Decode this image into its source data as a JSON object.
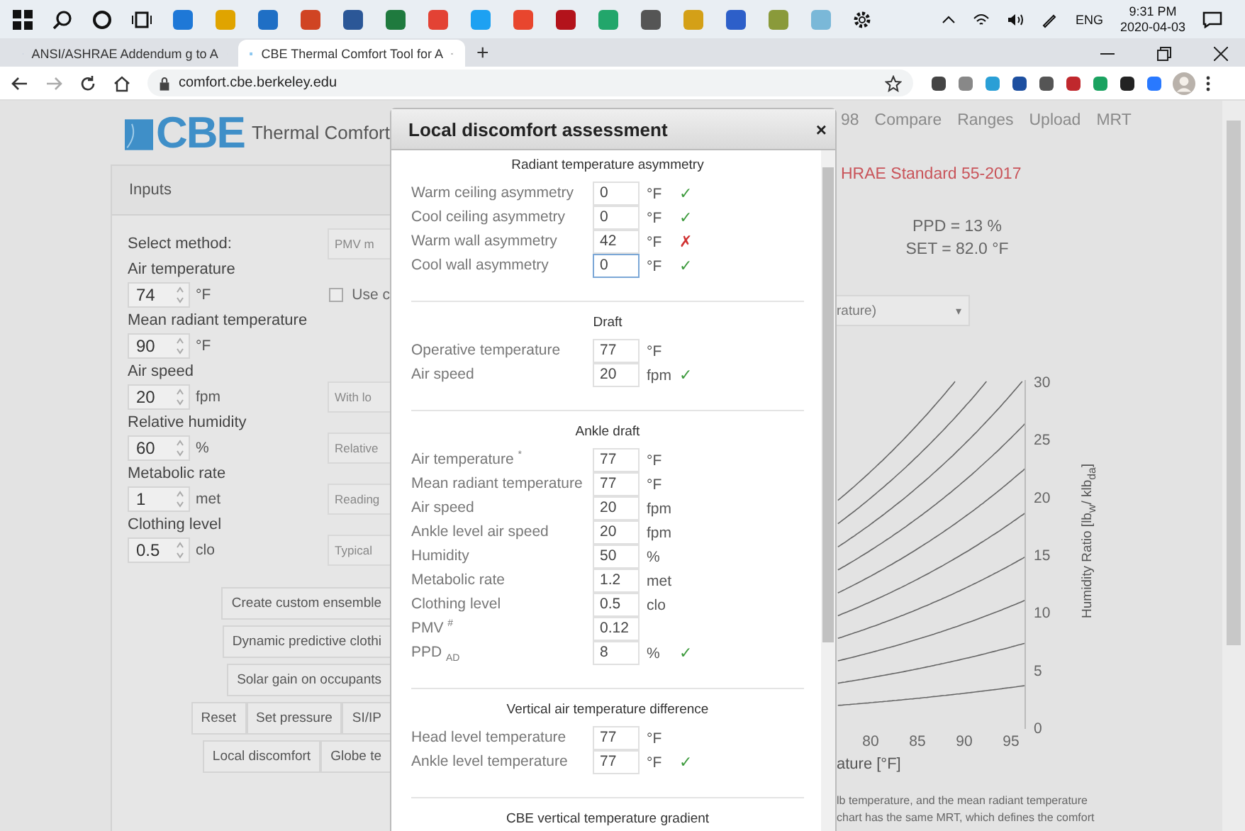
{
  "taskbar": {
    "language": "ENG",
    "time": "9:31 PM",
    "date": "2020-04-03"
  },
  "browser": {
    "tabs": [
      {
        "title": "ANSI/ASHRAE Addendum g to A",
        "selected": false
      },
      {
        "title": "CBE Thermal Comfort Tool for A",
        "selected": true
      }
    ],
    "new_tab": "+",
    "url": "comfort.cbe.berkeley.edu"
  },
  "page": {
    "logo": "CBE",
    "app_title": "Thermal Comfort",
    "nav": [
      "98",
      "Compare",
      "Ranges",
      "Upload",
      "MRT"
    ],
    "inputs": {
      "title": "Inputs",
      "method_label": "Select method:",
      "method_select": "PMV m",
      "fields": [
        {
          "label": "Air temperature",
          "value": "74",
          "unit": "°F",
          "side": {
            "kind": "checkbox",
            "label": "Use c",
            "checked": false
          }
        },
        {
          "label": "Mean radiant temperature",
          "value": "90",
          "unit": "°F"
        },
        {
          "label": "Air speed",
          "value": "20",
          "unit": "fpm",
          "side": {
            "kind": "select",
            "label": "With lo"
          }
        },
        {
          "label": "Relative humidity",
          "value": "60",
          "unit": "%",
          "side": {
            "kind": "select",
            "label": "Relative"
          }
        },
        {
          "label": "Metabolic rate",
          "value": "1",
          "unit": "met",
          "side": {
            "kind": "select",
            "label": "Reading"
          }
        },
        {
          "label": "Clothing level",
          "value": "0.5",
          "unit": "clo",
          "side": {
            "kind": "select",
            "label": "Typical"
          }
        }
      ]
    },
    "button_rows": [
      [
        "Create custom ensemble"
      ],
      [
        "Dynamic predictive clothi"
      ],
      [
        "Solar gain on occupants"
      ],
      [
        "Reset",
        "Set pressure",
        "SI/IP"
      ],
      [
        "Local discomfort",
        "Globe te"
      ]
    ],
    "standard": "HRAE Standard 55-2017",
    "results": [
      "PPD = 13 %",
      "SET = 82.0 °F"
    ],
    "chart_select": "rature)",
    "chart_select_caret": "▾",
    "chart": {
      "x_ticks": [
        "80",
        "85",
        "90",
        "95"
      ],
      "y_ticks": [
        "30",
        "25",
        "20",
        "15",
        "10",
        "5",
        "0"
      ],
      "x_label": "ature [°F]",
      "y_label": "Humidity Ratio [lb$_{w}$/ klb$_{da}$]"
    },
    "footnote": [
      "lb temperature, and the mean radiant temperature",
      "chart has the same MRT, which defines the comfort"
    ]
  },
  "modal": {
    "title": "Local discomfort assessment",
    "close": "×",
    "sections": [
      {
        "title": "Radiant temperature asymmetry",
        "rows": [
          {
            "label": "Warm ceiling asymmetry",
            "value": "0",
            "unit": "°F",
            "ok": true,
            "mark": "✓",
            "focused": false
          },
          {
            "label": "Cool ceiling asymmetry",
            "value": "0",
            "unit": "°F",
            "ok": true,
            "mark": "✓",
            "focused": false
          },
          {
            "label": "Warm wall asymmetry",
            "value": "42",
            "unit": "°F",
            "ok": false,
            "mark": "✗",
            "focused": false
          },
          {
            "label": "Cool wall asymmetry",
            "value": "0",
            "unit": "°F",
            "ok": true,
            "mark": "✓",
            "focused": true
          }
        ]
      },
      {
        "title": "Draft",
        "rows": [
          {
            "label": "Operative temperature",
            "value": "77",
            "unit": "°F",
            "focused": false
          },
          {
            "label": "Air speed",
            "value": "20",
            "unit": "fpm",
            "ok": true,
            "mark": "✓",
            "focused": false
          }
        ]
      },
      {
        "title": "Ankle draft",
        "rows": [
          {
            "label": "Air temperature $^{*}$",
            "value": "77",
            "unit": "°F",
            "focused": false
          },
          {
            "label": "Mean radiant temperature",
            "value": "77",
            "unit": "°F",
            "focused": false
          },
          {
            "label": "Air speed",
            "value": "20",
            "unit": "fpm",
            "focused": false
          },
          {
            "label": "Ankle level air speed",
            "value": "20",
            "unit": "fpm",
            "focused": false
          },
          {
            "label": "Humidity",
            "value": "50",
            "unit": "%",
            "focused": false
          },
          {
            "label": "Metabolic rate",
            "value": "1.2",
            "unit": "met",
            "focused": false
          },
          {
            "label": "Clothing level",
            "value": "0.5",
            "unit": "clo",
            "focused": false
          },
          {
            "label": "PMV $^{#}$",
            "value": "0.12",
            "focused": false
          },
          {
            "label": "PPD $_{AD}$",
            "value": "8",
            "unit": "%",
            "ok": true,
            "mark": "✓",
            "focused": false
          }
        ]
      },
      {
        "title": "Vertical air temperature difference",
        "rows": [
          {
            "label": "Head level temperature",
            "value": "77",
            "unit": "°F",
            "focused": false
          },
          {
            "label": "Ankle level temperature",
            "value": "77",
            "unit": "°F",
            "ok": true,
            "mark": "✓",
            "focused": false
          }
        ]
      },
      {
        "title": "CBE vertical temperature gradient"
      }
    ]
  }
}
